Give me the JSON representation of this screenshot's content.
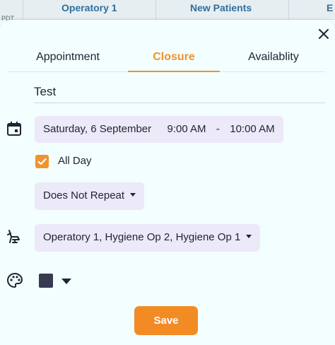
{
  "background": {
    "timezone": "PDT",
    "columns": [
      "Operatory 1",
      "New Patients",
      "E"
    ]
  },
  "tabs": [
    {
      "label": "Appointment"
    },
    {
      "label": "Closure"
    },
    {
      "label": "Availablity"
    }
  ],
  "active_tab": "Closure",
  "title_value": "Test",
  "schedule": {
    "date": "Saturday, 6 September",
    "start": "9:00 AM",
    "separator": "-",
    "end": "10:00 AM"
  },
  "all_day": {
    "label": "All Day",
    "checked": true
  },
  "repeat": {
    "value": "Does Not Repeat"
  },
  "operatories": {
    "value": "Operatory 1, Hygiene Op 2, Hygiene Op 1"
  },
  "color": {
    "value": "#363b52"
  },
  "save_label": "Save",
  "colors": {
    "accent": "#f0922e",
    "button": "#f38b25",
    "pill": "#ece9f8"
  }
}
